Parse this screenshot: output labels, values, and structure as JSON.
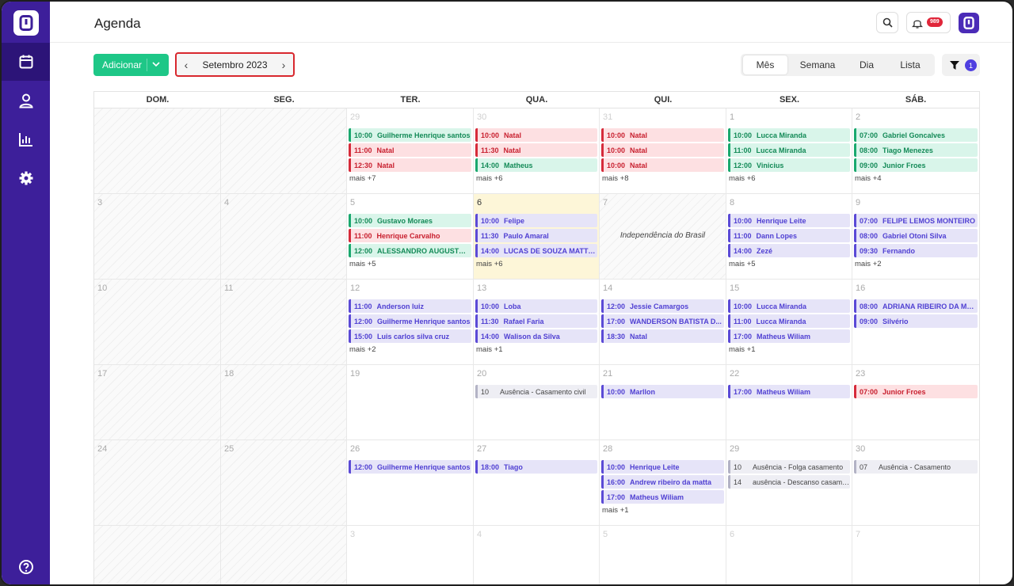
{
  "app": {
    "page_title": "Agenda",
    "notification_count": "989"
  },
  "toolbar": {
    "add_label": "Adicionar",
    "month_label": "Setembro 2023",
    "prev_glyph": "‹",
    "next_glyph": "›",
    "views": [
      "Mês",
      "Semana",
      "Dia",
      "Lista"
    ],
    "active_view": "Mês",
    "filter_count": "1"
  },
  "colors": {
    "sidebar": "#3d1f9a",
    "accent": "#4f3fe0",
    "add_button": "#1ec787",
    "month_highlight": "#d8282e"
  },
  "sidebar": {
    "items": [
      "calendar-icon",
      "user-icon",
      "chart-icon",
      "settings-icon"
    ],
    "help": "help-icon"
  },
  "calendar": {
    "headers": [
      "DOM.",
      "SEG.",
      "TER.",
      "QUA.",
      "QUI.",
      "SEX.",
      "SÁB."
    ],
    "weeks": [
      [
        {
          "day": "",
          "hatch": true
        },
        {
          "day": "",
          "hatch": true
        },
        {
          "day": "29",
          "muted": true,
          "events": [
            {
              "time": "10:00",
              "name": "Guilherme Henrique santos",
              "color": "green"
            },
            {
              "time": "11:00",
              "name": "Natal",
              "color": "red"
            },
            {
              "time": "12:30",
              "name": "Natal",
              "color": "red"
            }
          ],
          "more": "mais +7"
        },
        {
          "day": "30",
          "muted": true,
          "events": [
            {
              "time": "10:00",
              "name": "Natal",
              "color": "red"
            },
            {
              "time": "11:30",
              "name": "Natal",
              "color": "red"
            },
            {
              "time": "14:00",
              "name": "Matheus",
              "color": "green"
            }
          ],
          "more": "mais +6"
        },
        {
          "day": "31",
          "muted": true,
          "events": [
            {
              "time": "10:00",
              "name": "Natal",
              "color": "red"
            },
            {
              "time": "10:00",
              "name": "Natal",
              "color": "red"
            },
            {
              "time": "10:00",
              "name": "Natal",
              "color": "red"
            }
          ],
          "more": "mais +8"
        },
        {
          "day": "1",
          "events": [
            {
              "time": "10:00",
              "name": "Lucca Miranda",
              "color": "green"
            },
            {
              "time": "11:00",
              "name": "Lucca Miranda",
              "color": "green"
            },
            {
              "time": "12:00",
              "name": "Vinicius",
              "color": "green"
            }
          ],
          "more": "mais +6"
        },
        {
          "day": "2",
          "events": [
            {
              "time": "07:00",
              "name": "Gabriel Goncalves",
              "color": "green"
            },
            {
              "time": "08:00",
              "name": "Tiago Menezes",
              "color": "green"
            },
            {
              "time": "09:00",
              "name": "Junior Froes",
              "color": "green"
            }
          ],
          "more": "mais +4"
        }
      ],
      [
        {
          "day": "3",
          "hatch": true
        },
        {
          "day": "4",
          "hatch": true
        },
        {
          "day": "5",
          "events": [
            {
              "time": "10:00",
              "name": "Gustavo Moraes",
              "color": "green"
            },
            {
              "time": "11:00",
              "name": "Henrique Carvalho",
              "color": "red"
            },
            {
              "time": "12:00",
              "name": "ALESSANDRO AUGUSTO ...",
              "color": "green"
            }
          ],
          "more": "mais +5"
        },
        {
          "day": "6",
          "today": true,
          "events": [
            {
              "time": "10:00",
              "name": "Felipe",
              "color": "purple"
            },
            {
              "time": "11:30",
              "name": "Paulo Amaral",
              "color": "purple"
            },
            {
              "time": "14:00",
              "name": "LUCAS DE SOUZA MATTOS",
              "color": "purple"
            }
          ],
          "more": "mais +6"
        },
        {
          "day": "7",
          "hatch": true,
          "holiday": "Independência do Brasil"
        },
        {
          "day": "8",
          "events": [
            {
              "time": "10:00",
              "name": "Henrique Leite",
              "color": "purple"
            },
            {
              "time": "11:00",
              "name": "Dann Lopes",
              "color": "purple"
            },
            {
              "time": "14:00",
              "name": "Zezé",
              "color": "purple"
            }
          ],
          "more": "mais +5"
        },
        {
          "day": "9",
          "events": [
            {
              "time": "07:00",
              "name": "FELIPE LEMOS MONTEIRO",
              "color": "purple"
            },
            {
              "time": "08:00",
              "name": "Gabriel Otoni Silva",
              "color": "purple"
            },
            {
              "time": "09:30",
              "name": "Fernando",
              "color": "purple"
            }
          ],
          "more": "mais +2"
        }
      ],
      [
        {
          "day": "10",
          "hatch": true
        },
        {
          "day": "11",
          "hatch": true
        },
        {
          "day": "12",
          "events": [
            {
              "time": "11:00",
              "name": "Anderson luiz",
              "color": "purple"
            },
            {
              "time": "12:00",
              "name": "Guilherme Henrique santos",
              "color": "purple"
            },
            {
              "time": "15:00",
              "name": "Luis carlos silva cruz",
              "color": "purple"
            }
          ],
          "more": "mais +2"
        },
        {
          "day": "13",
          "events": [
            {
              "time": "10:00",
              "name": "Loba",
              "color": "purple"
            },
            {
              "time": "11:30",
              "name": "Rafael Faria",
              "color": "purple"
            },
            {
              "time": "14:00",
              "name": "Walison da Silva",
              "color": "purple"
            }
          ],
          "more": "mais +1"
        },
        {
          "day": "14",
          "events": [
            {
              "time": "12:00",
              "name": "Jessie Camargos",
              "color": "purple"
            },
            {
              "time": "17:00",
              "name": "WANDERSON BATISTA D...",
              "color": "purple"
            },
            {
              "time": "18:30",
              "name": "Natal",
              "color": "purple"
            }
          ]
        },
        {
          "day": "15",
          "events": [
            {
              "time": "10:00",
              "name": "Lucca Miranda",
              "color": "purple"
            },
            {
              "time": "11:00",
              "name": "Lucca Miranda",
              "color": "purple"
            },
            {
              "time": "17:00",
              "name": "Matheus Wiliam",
              "color": "purple"
            }
          ],
          "more": "mais +1"
        },
        {
          "day": "16",
          "events": [
            {
              "time": "08:00",
              "name": "ADRIANA RIBEIRO DA MA...",
              "color": "purple"
            },
            {
              "time": "09:00",
              "name": "Silvério",
              "color": "purple"
            }
          ]
        }
      ],
      [
        {
          "day": "17",
          "hatch": true
        },
        {
          "day": "18",
          "hatch": true
        },
        {
          "day": "19"
        },
        {
          "day": "20",
          "events": [
            {
              "time": "10",
              "name": "Ausência - Casamento civil",
              "color": "gray"
            }
          ]
        },
        {
          "day": "21",
          "events": [
            {
              "time": "10:00",
              "name": "Marllon",
              "color": "purple"
            }
          ]
        },
        {
          "day": "22",
          "events": [
            {
              "time": "17:00",
              "name": "Matheus Wiliam",
              "color": "purple"
            }
          ]
        },
        {
          "day": "23",
          "events": [
            {
              "time": "07:00",
              "name": "Junior Froes",
              "color": "red"
            }
          ]
        }
      ],
      [
        {
          "day": "24",
          "hatch": true
        },
        {
          "day": "25",
          "hatch": true
        },
        {
          "day": "26",
          "events": [
            {
              "time": "12:00",
              "name": "Guilherme Henrique santos",
              "color": "purple"
            }
          ]
        },
        {
          "day": "27",
          "events": [
            {
              "time": "18:00",
              "name": "Tiago",
              "color": "purple"
            }
          ]
        },
        {
          "day": "28",
          "events": [
            {
              "time": "10:00",
              "name": "Henrique Leite",
              "color": "purple"
            },
            {
              "time": "16:00",
              "name": "Andrew ribeiro da matta",
              "color": "purple"
            },
            {
              "time": "17:00",
              "name": "Matheus Wiliam",
              "color": "purple"
            }
          ],
          "more": "mais +1"
        },
        {
          "day": "29",
          "events": [
            {
              "time": "10",
              "name": "Ausência - Folga casamento",
              "color": "gray"
            },
            {
              "time": "14",
              "name": "ausência - Descanso casamento",
              "color": "gray"
            }
          ]
        },
        {
          "day": "30",
          "events": [
            {
              "time": "07",
              "name": "Ausência - Casamento",
              "color": "gray"
            }
          ]
        }
      ],
      [
        {
          "day": "",
          "hatch": true
        },
        {
          "day": "",
          "hatch": true
        },
        {
          "day": "3",
          "muted": true
        },
        {
          "day": "4",
          "muted": true
        },
        {
          "day": "5",
          "muted": true
        },
        {
          "day": "6",
          "muted": true
        },
        {
          "day": "7",
          "muted": true
        }
      ]
    ]
  }
}
